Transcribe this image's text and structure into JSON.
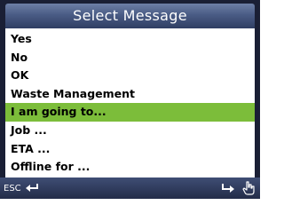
{
  "header": {
    "title": "Select Message"
  },
  "messages": {
    "items": [
      {
        "label": "Yes",
        "selected": false
      },
      {
        "label": "No",
        "selected": false
      },
      {
        "label": "OK",
        "selected": false
      },
      {
        "label": "Waste Management",
        "selected": false
      },
      {
        "label": "I am going to...",
        "selected": true
      },
      {
        "label": "Job ...",
        "selected": false
      },
      {
        "label": "ETA ...",
        "selected": false
      },
      {
        "label": "Offline for ...",
        "selected": false
      }
    ]
  },
  "footer": {
    "esc_label": "ESC",
    "icons": {
      "back": "return-arrow-icon",
      "enter": "enter-arrow-icon",
      "hand": "hand-pointer-icon"
    }
  },
  "colors": {
    "selected_row": "#7cbd3a",
    "title_bar": "#4a5c85",
    "footer_bar": "#2c3757"
  }
}
